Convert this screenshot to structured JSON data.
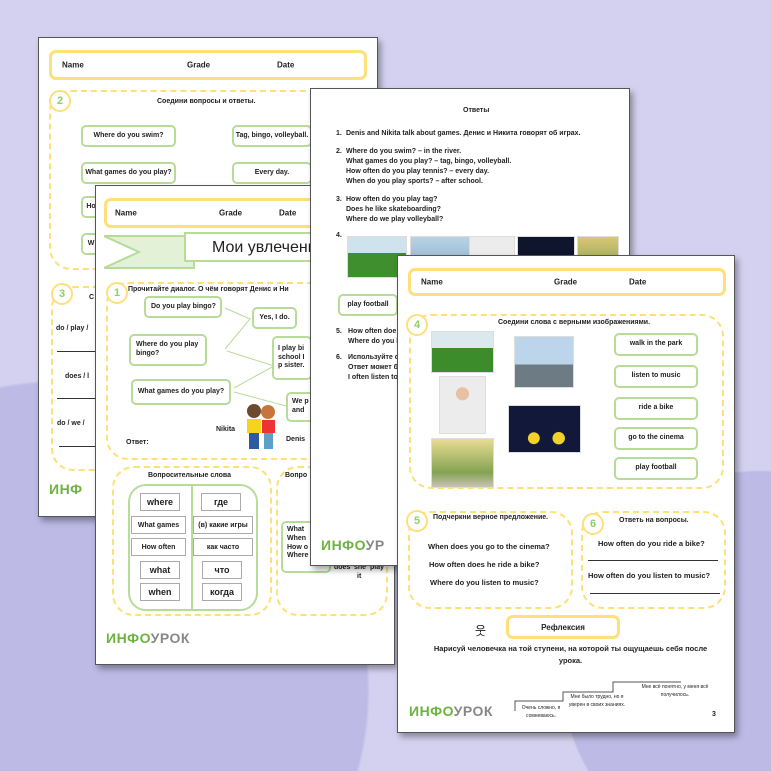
{
  "header": {
    "name": "Name",
    "grade": "Grade",
    "date": "Date"
  },
  "page1": {
    "task2_num": "2",
    "task2_title": "Соедини вопросы и ответы.",
    "questions": [
      "Where do you swim?",
      "What games do you play?",
      "Ho",
      "W"
    ],
    "answers": [
      "Tag, bingo, volleyball.",
      "Every day."
    ],
    "task3_num": "3",
    "task3_title": "С",
    "words": [
      "do / play /",
      "does / l",
      "do / we /"
    ],
    "logo": "ИНФ"
  },
  "page2": {
    "title": "Мои увлечения",
    "task1_num": "1",
    "task1_title": "Прочитайте диалог. О чём говорят Денис и Ни",
    "bubbles_left": [
      "Do you play bingo?",
      "Where do you play bingo?",
      "What games do you play?"
    ],
    "bubbles_right": [
      "Yes, I do.",
      "I play bi school I p sister.",
      "We p and"
    ],
    "nikita": "Nikita",
    "denis": "Denis",
    "answer_label": "Ответ:",
    "qwords_title": "Вопросительные слова",
    "qwords_en": [
      "where",
      "What games",
      "How often",
      "what",
      "when"
    ],
    "qwords_ru": [
      "где",
      "(в) какие игры",
      "как часто",
      "что",
      "когда"
    ],
    "right_title": "Вопро",
    "right_box": [
      "What",
      "When",
      "How o",
      "Where"
    ],
    "right_extra": [
      "does",
      "she",
      "it",
      "play"
    ],
    "logo_green": "ИНФО",
    "logo_gray": "УРОК"
  },
  "page3": {
    "title": "Ответы",
    "items": [
      {
        "n": "1.",
        "lines": [
          "Denis and Nikita talk about games. Денис и Никита говорят об играх."
        ]
      },
      {
        "n": "2.",
        "lines": [
          "Where do you swim? – in the river.",
          "What games do you play? – tag, bingo, volleyball.",
          "How often do you play tennis? – every day.",
          "When do you play sports? – after school."
        ]
      },
      {
        "n": "3.",
        "lines": [
          "How often do you play tag?",
          "Does he like skateboarding?",
          "Where do we play volleyball?"
        ]
      },
      {
        "n": "4.",
        "lines": []
      },
      {
        "n": "5.",
        "lines": [
          "How often doe",
          "Where do you l"
        ]
      },
      {
        "n": "6.",
        "lines": [
          "Используйте сл",
          "Ответ может б",
          "I often listen to"
        ]
      }
    ],
    "box": "play football",
    "logo_green": "ИНФО",
    "logo_gray": "УР"
  },
  "page4": {
    "task4_num": "4",
    "task4_title": "Соедини слова с верными изображениями.",
    "phrases": [
      "walk in the park",
      "listen to music",
      "ride a bike",
      "go to the cinema",
      "play football"
    ],
    "task5_num": "5",
    "task5_title": "Подчеркни верное предложение.",
    "sentences": [
      "When does you go to the cinema?",
      "How often does he ride a bike?",
      "Where do you listen to music?"
    ],
    "task6_num": "6",
    "task6_title": "Ответь на вопросы.",
    "questions": [
      "How often do you ride a bike?",
      "How often do you listen to music?"
    ],
    "reflection": "Рефлексия",
    "instruction": "Нарисуй человечка на той ступени, на которой ты ощущаешь себя после урока.",
    "steps": [
      "Очень сложно, я сомневаюсь.",
      "Мне было трудно, но я уверен в своих знаниях.",
      "Мне всё понятно, у меня всё получилось."
    ],
    "logo_green": "ИНФО",
    "logo_gray": "УРОК",
    "page_number": "3"
  },
  "colors": {
    "background": "#d3d1ef",
    "yellow": "#fde07a",
    "green": "#b7dc9a",
    "logo_green": "#6cb33e"
  }
}
